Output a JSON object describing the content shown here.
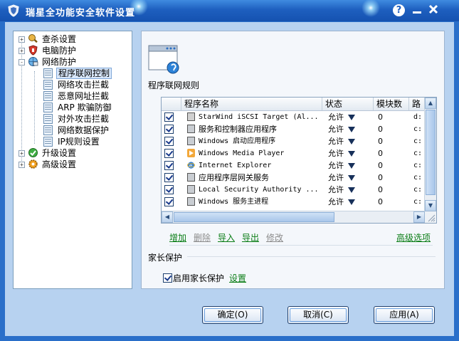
{
  "window": {
    "title": "瑞星全功能安全软件设置",
    "help_label": "?",
    "minimize_label": "━",
    "close_label": "✕"
  },
  "tree": {
    "nodes": [
      {
        "label": "查杀设置",
        "expander": "+",
        "icon": "magnifier-shield-icon"
      },
      {
        "label": "电脑防护",
        "expander": "+",
        "icon": "red-shield-icon"
      },
      {
        "label": "网络防护",
        "expander": "-",
        "icon": "network-globe-icon"
      },
      {
        "label": "程序联网控制",
        "icon": "page-icon",
        "selected": true
      },
      {
        "label": "网络攻击拦截",
        "icon": "page-icon"
      },
      {
        "label": "恶意网址拦截",
        "icon": "page-icon"
      },
      {
        "label": "ARP 欺骗防御",
        "icon": "page-icon"
      },
      {
        "label": "对外攻击拦截",
        "icon": "page-icon"
      },
      {
        "label": "网络数据保护",
        "icon": "page-icon"
      },
      {
        "label": "IP规则设置",
        "icon": "page-icon"
      },
      {
        "label": "升级设置",
        "expander": "+",
        "icon": "green-upgrade-icon"
      },
      {
        "label": "高级设置",
        "expander": "+",
        "icon": "gear-icon"
      }
    ]
  },
  "main": {
    "section_title": "程序联网规则",
    "table": {
      "columns": [
        "程序名称",
        "状态",
        "模块数",
        "路"
      ],
      "rows": [
        {
          "name": "StarWind iSCSI Target (Al...",
          "status": "允许",
          "modules": "0",
          "path": "d:",
          "mono": true
        },
        {
          "name": "服务和控制器应用程序",
          "status": "允许",
          "modules": "0",
          "path": "c:",
          "mono": false
        },
        {
          "name": "Windows 启动应用程序",
          "status": "允许",
          "modules": "0",
          "path": "c:",
          "mono": true
        },
        {
          "name": "Windows Media Player",
          "status": "允许",
          "modules": "0",
          "path": "c:",
          "mono": true
        },
        {
          "name": "Internet Explorer",
          "status": "允许",
          "modules": "0",
          "path": "c:",
          "mono": true
        },
        {
          "name": "应用程序层网关服务",
          "status": "允许",
          "modules": "0",
          "path": "c:",
          "mono": false
        },
        {
          "name": "Local Security Authority ...",
          "status": "允许",
          "modules": "0",
          "path": "c:",
          "mono": true
        },
        {
          "name": "Windows 服务主进程",
          "status": "允许",
          "modules": "0",
          "path": "c:",
          "mono": true
        }
      ]
    },
    "actions": {
      "add": "增加",
      "delete": "删除",
      "import": "导入",
      "export": "导出",
      "modify": "修改",
      "advanced": "高级选项"
    },
    "parental": {
      "title": "家长保护",
      "enable_label": "启用家长保护",
      "settings_link": "设置",
      "enabled": true
    }
  },
  "buttons": {
    "ok": "确定(O)",
    "cancel": "取消(C)",
    "apply": "应用(A)"
  },
  "colors": {
    "title_bar": "#1e5fbf",
    "client_bg": "#b7d2f0",
    "link_green": "#0a7d16",
    "disabled_gray": "#8c8c8c"
  }
}
